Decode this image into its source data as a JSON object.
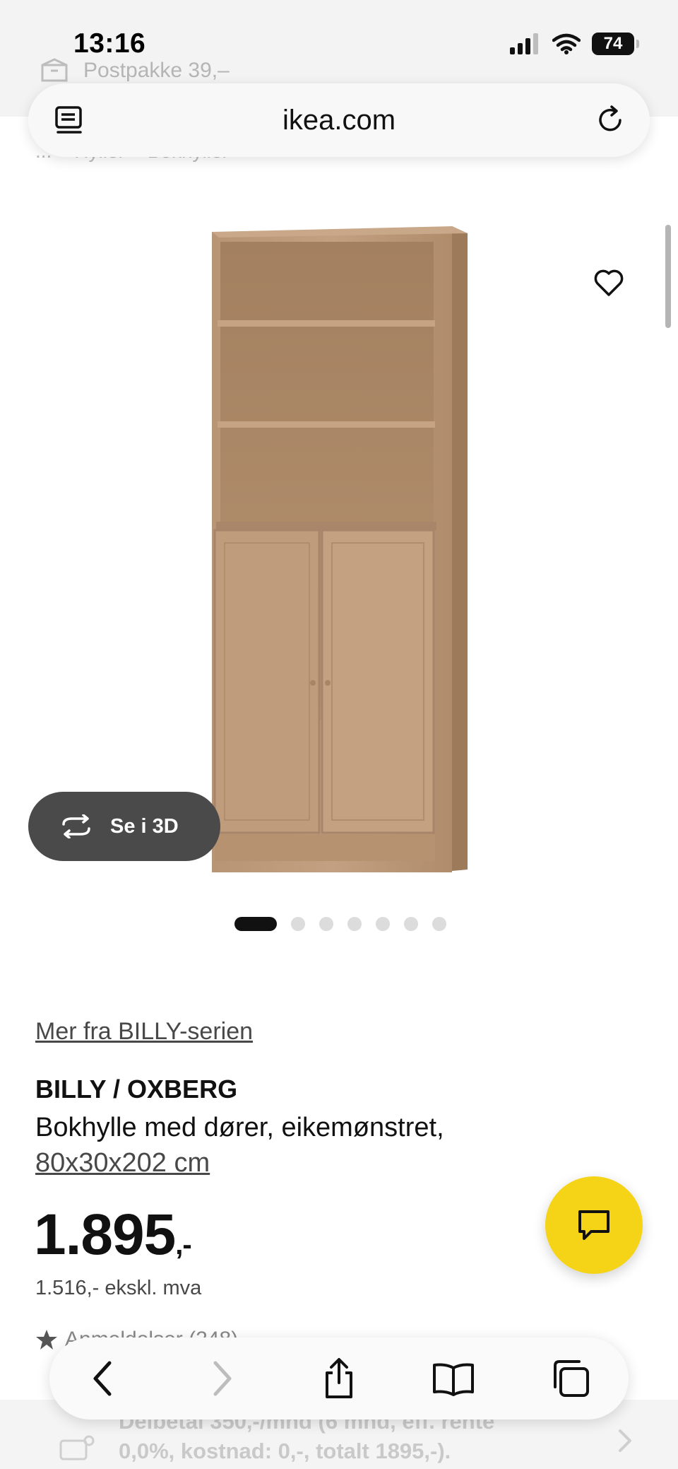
{
  "status_bar": {
    "time": "13:16",
    "battery": "74"
  },
  "promo": {
    "text": "Postpakke 39,–"
  },
  "browser": {
    "url": "ikea.com"
  },
  "breadcrumb": "... > Hyller > Bokhyller",
  "see_3d": {
    "label": "Se i 3D"
  },
  "gallery": {
    "count": 7,
    "active_index": 0
  },
  "product": {
    "series_link": "Mer fra BILLY-serien",
    "name": "BILLY / OXBERG",
    "description": "Bokhylle med dører, eikemønstret,",
    "dimensions": "80x30x202 cm",
    "price": "1.895",
    "price_suffix": ",-",
    "price_ex_vat": "1.516,- ekskl. mva",
    "rating_text": "Anmeldelser (248)"
  },
  "installment": {
    "line1": "Delbetal 350,-/mnd (6 mnd, eff. rente",
    "line2": "0,0%, kostnad: 0,-, totalt 1895,-)."
  },
  "colors": {
    "chat_fab": "#f5d417",
    "see3d_bg": "#4a4a4a",
    "wood": "#b38f6e"
  },
  "icons": [
    "reader-icon",
    "reload-icon",
    "heart-icon",
    "rotate-3d-icon",
    "chat-icon",
    "back-icon",
    "forward-icon",
    "share-icon",
    "bookmarks-icon",
    "tabs-icon"
  ]
}
